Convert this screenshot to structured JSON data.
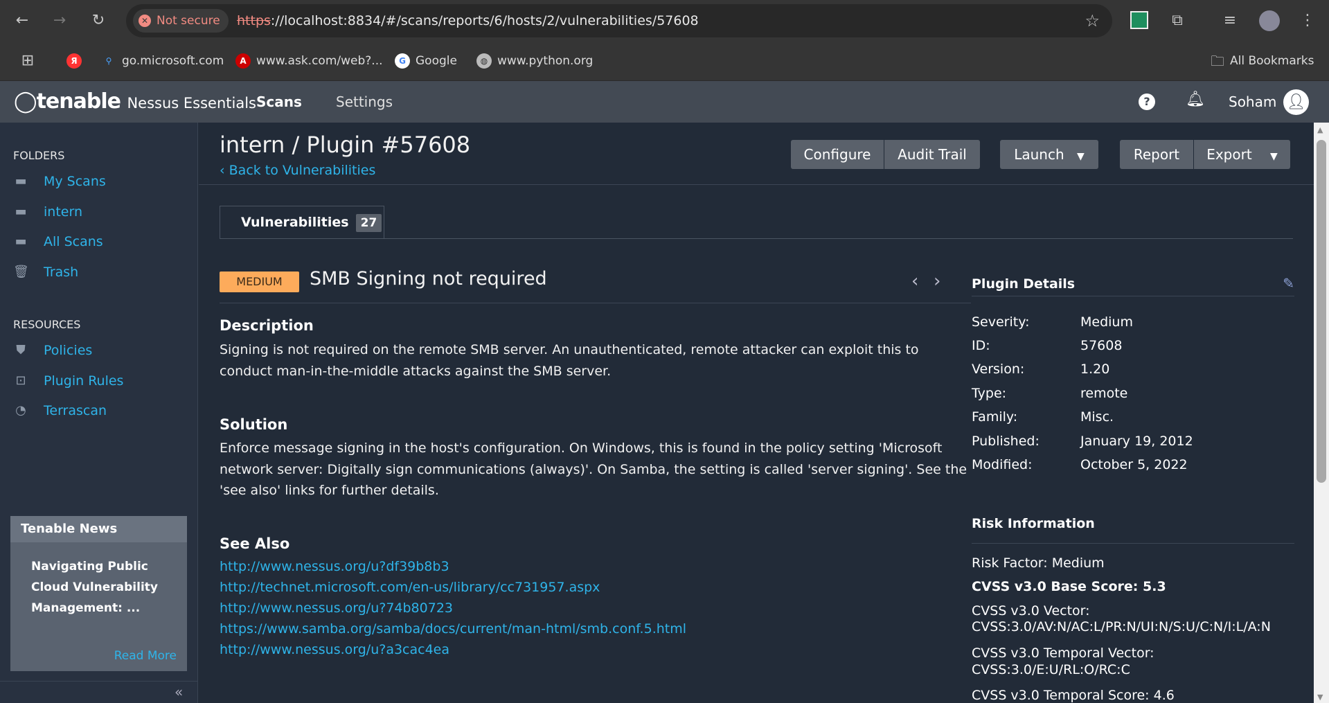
{
  "browser": {
    "not_secure": "Not secure",
    "url_scheme": "https",
    "url_rest": "://localhost:8834/#/scans/reports/6/hosts/2/vulnerabilities/57608",
    "bookmarks": [
      "go.microsoft.com",
      "www.ask.com/web?...",
      "Google",
      "www.python.org"
    ],
    "all_bookmarks": "All Bookmarks"
  },
  "header": {
    "brand": "tenable",
    "product": "Nessus Essentials",
    "nav": [
      "Scans",
      "Settings"
    ],
    "user": "Soham"
  },
  "sidebar": {
    "folders_heading": "FOLDERS",
    "folders": [
      "My Scans",
      "intern",
      "All Scans",
      "Trash"
    ],
    "resources_heading": "RESOURCES",
    "resources": [
      "Policies",
      "Plugin Rules",
      "Terrascan"
    ],
    "news": {
      "title": "Tenable News",
      "headline": "Navigating Public Cloud Vulnerability Management: ...",
      "read_more": "Read More"
    }
  },
  "page": {
    "title": "intern / Plugin #57608",
    "back": "Back to Vulnerabilities",
    "buttons": {
      "configure": "Configure",
      "audit": "Audit Trail",
      "launch": "Launch",
      "report": "Report",
      "export": "Export"
    },
    "tab": {
      "label": "Vulnerabilities",
      "count": "27"
    }
  },
  "vuln": {
    "severity": "MEDIUM",
    "severity_color": "#fdab5b",
    "name": "SMB Signing not required",
    "description_heading": "Description",
    "description": "Signing is not required on the remote SMB server. An unauthenticated, remote attacker can exploit this to conduct man-in-the-middle attacks against the SMB server.",
    "solution_heading": "Solution",
    "solution": "Enforce message signing in the host's configuration. On Windows, this is found in the policy setting 'Microsoft network server: Digitally sign communications (always)'. On Samba, the setting is called 'server signing'. See the 'see also' links for further details.",
    "see_also_heading": "See Also",
    "see_also": [
      "http://www.nessus.org/u?df39b8b3",
      "http://technet.microsoft.com/en-us/library/cc731957.aspx",
      "http://www.nessus.org/u?74b80723",
      "https://www.samba.org/samba/docs/current/man-html/smb.conf.5.html",
      "http://www.nessus.org/u?a3cac4ea"
    ]
  },
  "plugin_details": {
    "heading": "Plugin Details",
    "rows": [
      {
        "k": "Severity:",
        "v": "Medium"
      },
      {
        "k": "ID:",
        "v": "57608"
      },
      {
        "k": "Version:",
        "v": "1.20"
      },
      {
        "k": "Type:",
        "v": "remote"
      },
      {
        "k": "Family:",
        "v": "Misc."
      },
      {
        "k": "Published:",
        "v": "January 19, 2012"
      },
      {
        "k": "Modified:",
        "v": "October 5, 2022"
      }
    ]
  },
  "risk": {
    "heading": "Risk Information",
    "risk_factor": "Risk Factor: Medium",
    "base_score": "CVSS v3.0 Base Score: 5.3",
    "vector_label": "CVSS v3.0 Vector:",
    "vector": "CVSS:3.0/AV:N/AC:L/PR:N/UI:N/S:U/C:N/I:L/A:N",
    "temporal_vector_label": "CVSS v3.0 Temporal Vector:",
    "temporal_vector": "CVSS:3.0/E:U/RL:O/RC:C",
    "temporal_score": "CVSS v3.0 Temporal Score: 4.6"
  }
}
